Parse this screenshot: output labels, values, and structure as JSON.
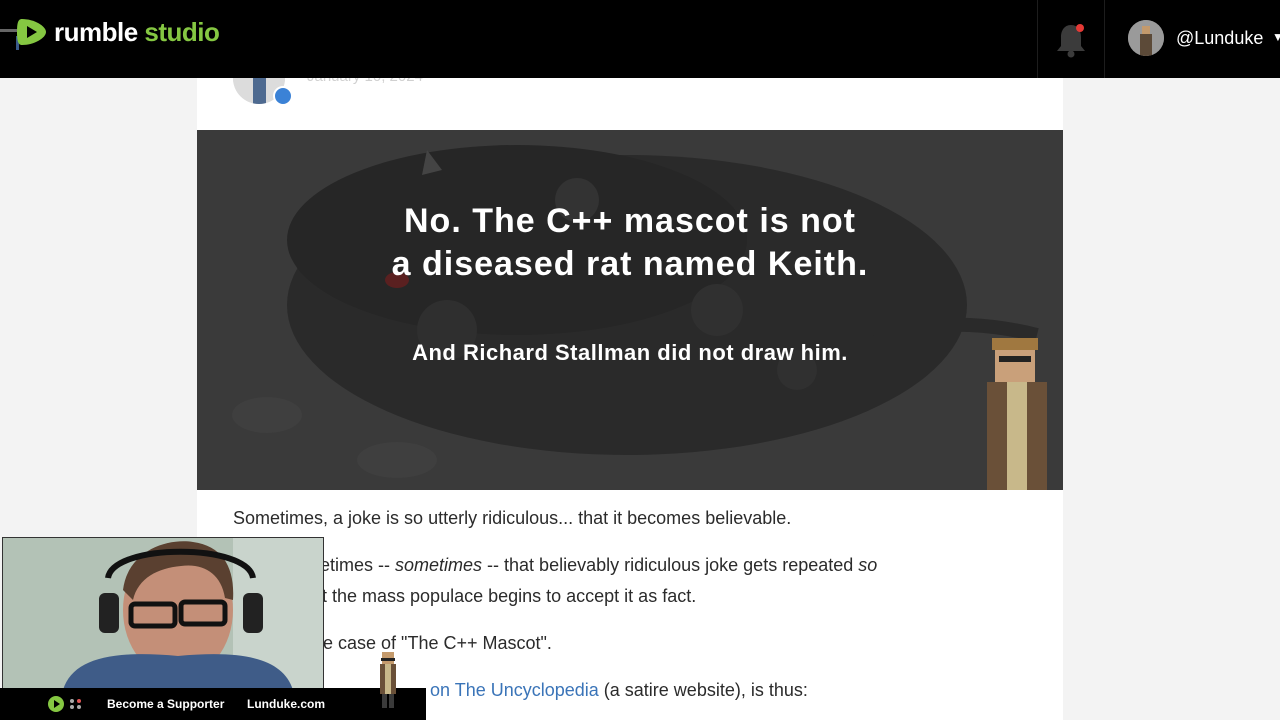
{
  "topbar": {
    "logo_text": "rumble",
    "logo_studio": " studio",
    "username": "@Lunduke",
    "colors": {
      "brand_green": "#85c742",
      "notification_dot": "#e53935"
    }
  },
  "article": {
    "date": "January 10, 2024",
    "hero": {
      "line1": "No.  The C++ mascot is not",
      "line2": "a diseased rat named Keith.",
      "line3": "And Richard Stallman did not draw him."
    },
    "p1": "Sometimes, a joke is so utterly ridiculous... that it becomes believable.",
    "p2a_start": "etimes -- ",
    "p2a_ital": "sometimes",
    "p2a_mid": " -- that believably ridiculous joke gets repeated ",
    "p2a_end": "so",
    "p2b": "t the mass populace begins to accept it as fact.",
    "p3": "he case of \"The C++ Mascot\".",
    "p4_link": "on The Uncyclopedia",
    "p4_rest": " (a satire website), is thus:"
  },
  "overlay": {
    "bottom_bar": {
      "supporter": "Become a Supporter",
      "site": "Lunduke.com"
    }
  }
}
